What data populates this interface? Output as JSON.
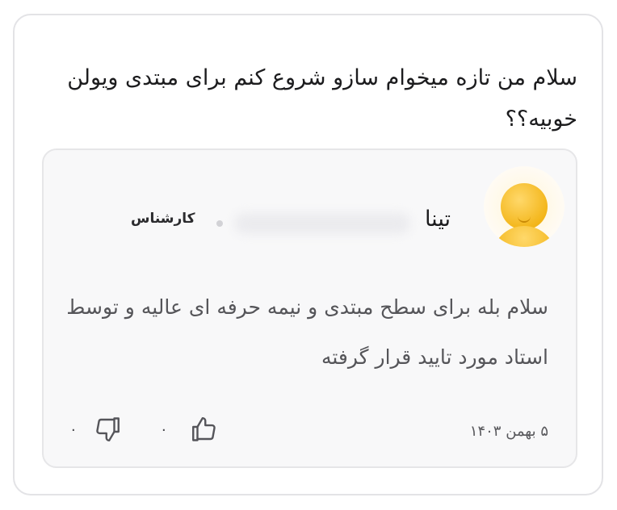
{
  "question": {
    "text": "سلام من تازه میخوام سازو شروع کنم برای مبتدی ویولن خوبیه؟؟"
  },
  "answer": {
    "author_name": "تینا",
    "author_badge": "کارشناس",
    "text": "سلام بله برای سطح مبتدی و نیمه حرفه ای عالیه و توسط استاد مورد تایید قرار گرفته",
    "date": "۵ بهمن ۱۴۰۳",
    "likes": "۰",
    "dislikes": "۰"
  },
  "icons": {
    "like": "thumbs-up-icon",
    "dislike": "thumbs-down-icon",
    "avatar": "default-avatar"
  },
  "colors": {
    "avatar": "#f3b61b",
    "text_primary": "#1c1c1e",
    "text_secondary": "#555559"
  }
}
